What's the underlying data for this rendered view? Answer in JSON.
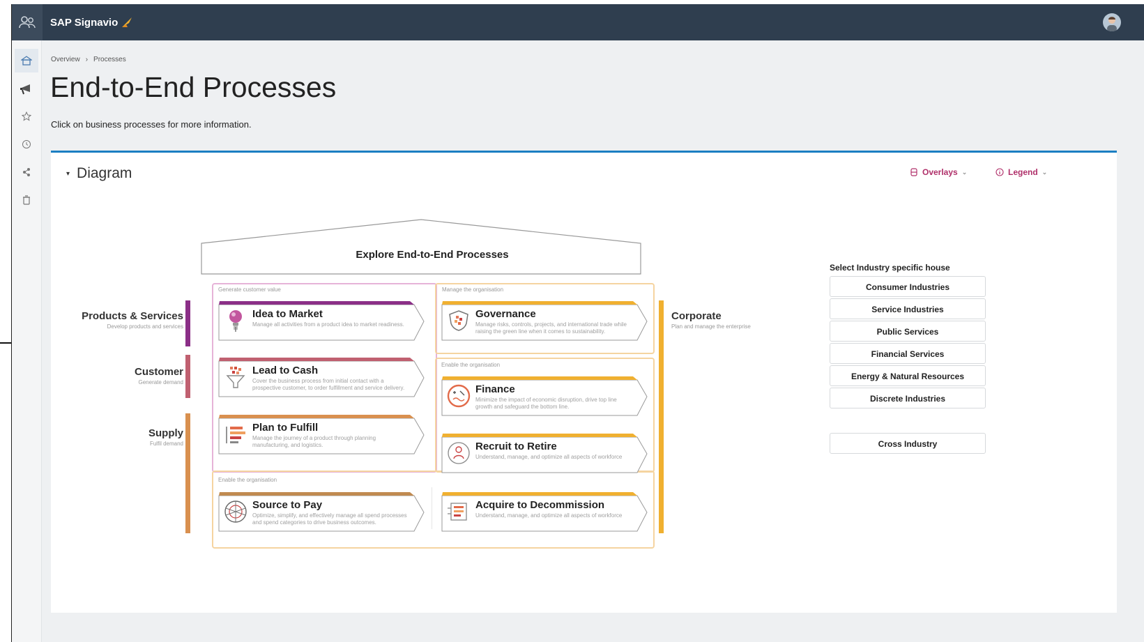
{
  "app": {
    "name": "SAP Signavio"
  },
  "breadcrumb": {
    "items": [
      "Overview",
      "Processes"
    ],
    "separator": "›"
  },
  "page": {
    "title": "End-to-End Processes",
    "subtitle": "Click on business processes for more information."
  },
  "diagram": {
    "header": "Diagram",
    "overlays_label": "Overlays",
    "legend_label": "Legend",
    "roof_title": "Explore End-to-End Processes",
    "rows": {
      "products": {
        "name": "Products & Services",
        "desc": "Develop products and services"
      },
      "customer": {
        "name": "Customer",
        "desc": "Generate demand"
      },
      "supply": {
        "name": "Supply",
        "desc": "Fulfil demand"
      },
      "corporate": {
        "name": "Corporate",
        "desc": "Plan and manage the enterprise"
      }
    },
    "groups": {
      "generate": "Generate customer value",
      "manage": "Manage the organisation",
      "enable_right": "Enable the organisation",
      "enable_bottom": "Enable the organisation"
    },
    "processes": {
      "idea_to_market": {
        "name": "Idea to Market",
        "desc": "Manage all activities from a product idea to market readiness."
      },
      "lead_to_cash": {
        "name": "Lead to Cash",
        "desc": "Cover the business process from initial contact with a prospective customer, to order fulfillment and service delivery."
      },
      "plan_to_fulfill": {
        "name": "Plan to Fulfill",
        "desc": "Manage the journey of a product through planning manufacturing, and logistics."
      },
      "source_to_pay": {
        "name": "Source to Pay",
        "desc": "Optimize, simplify, and effectively manage all spend processes and spend categories to drive business outcomes."
      },
      "governance": {
        "name": "Governance",
        "desc": "Manage risks, controls, projects, and international trade while raising the green line when it comes to sustainability."
      },
      "finance": {
        "name": "Finance",
        "desc": "Minimize the impact of economic disruption, drive top line growth and safeguard the bottom line."
      },
      "recruit_to_retire": {
        "name": "Recruit to Retire",
        "desc": "Understand, manage, and optimize all aspects of workforce"
      },
      "acquire_to_decommission": {
        "name": "Acquire to Decommission",
        "desc": "Understand, manage, and optimize all aspects of workforce"
      }
    },
    "industry": {
      "title": "Select Industry specific house",
      "items": [
        "Consumer Industries",
        "Service Industries",
        "Public Services",
        "Financial Services",
        "Energy & Natural Resources",
        "Discrete Industries"
      ],
      "cross": "Cross Industry"
    }
  },
  "colors": {
    "topbar": "#2f3e4f",
    "accent": "#1b7ec2",
    "purple": "#8b2f87",
    "customer": "#c06070",
    "supply": "#d9904f",
    "corporate": "#f0b030",
    "link": "#b0306a"
  },
  "icons": [
    "users-icon",
    "home-icon",
    "megaphone-icon",
    "star-icon",
    "history-icon",
    "share-icon",
    "trash-icon",
    "avatar-icon"
  ]
}
